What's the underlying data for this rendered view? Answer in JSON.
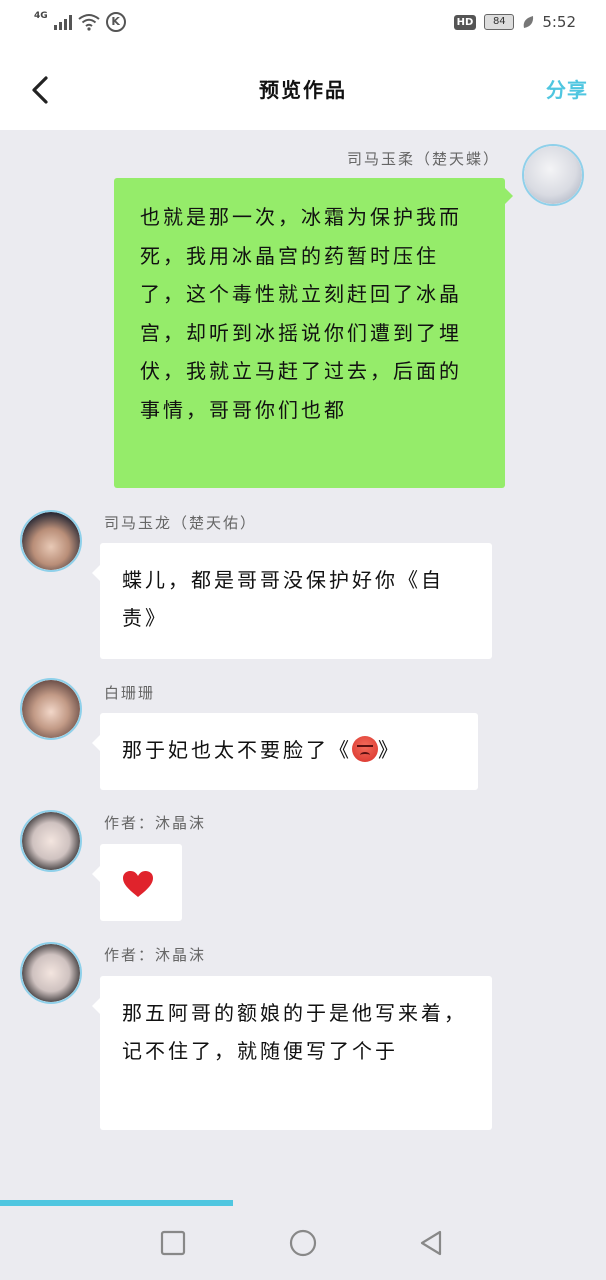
{
  "status_bar": {
    "network": "4G",
    "battery": "84",
    "time": "5:52",
    "hd_label": "HD",
    "k_label": "K"
  },
  "header": {
    "title": "预览作品",
    "share_label": "分享"
  },
  "messages": [
    {
      "side": "right",
      "name": "司马玉柔（楚天蝶）",
      "text": "也就是那一次，冰霜为保护我而死，我用冰晶宫的药暂时压住了，这个毒性就立刻赶回了冰晶宫，却听到冰摇说你们遭到了埋伏，我就立马赶了过去，后面的事情，哥哥你们也都",
      "color": "#95ec6a"
    },
    {
      "side": "left",
      "name": "司马玉龙（楚天佑）",
      "text": "蝶儿，都是哥哥没保护好你《自责》"
    },
    {
      "side": "left",
      "name": "白珊珊",
      "text_before": "那于妃也太不要脸了《",
      "emoji": "angry-face",
      "text_after": "》"
    },
    {
      "side": "left",
      "name": "作者：沐晶沫",
      "emoji": "red-heart"
    },
    {
      "side": "left",
      "name": "作者：沐晶沫",
      "text": "那五阿哥的额娘的于是他写来着，记不住了，就随便写了个于"
    }
  ],
  "progress": 0.385,
  "colors": {
    "accent": "#4fc6e0",
    "green_bubble": "#95ec6a",
    "background": "#ebebf0"
  },
  "icons": {
    "back": "chevron-left-icon",
    "nav_recent": "square-icon",
    "nav_home": "circle-icon",
    "nav_back": "triangle-back-icon"
  }
}
